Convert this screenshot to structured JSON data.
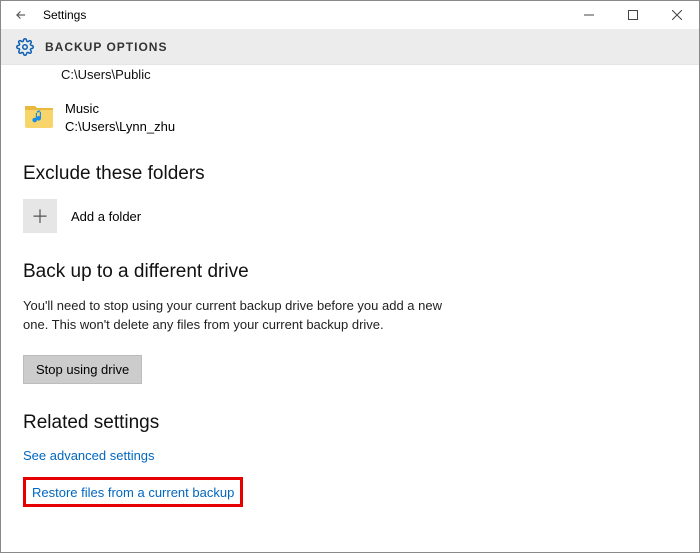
{
  "window": {
    "title": "Settings"
  },
  "page": {
    "header": "BACKUP OPTIONS",
    "truncated_path": "C:\\Users\\Public",
    "folder": {
      "name": "Music",
      "path": "C:\\Users\\Lynn_zhu"
    },
    "exclude": {
      "heading": "Exclude these folders",
      "add_label": "Add a folder"
    },
    "different_drive": {
      "heading": "Back up to a different drive",
      "description": "You'll need to stop using your current backup drive before you add a new one. This won't delete any files from your current backup drive.",
      "button": "Stop using drive"
    },
    "related": {
      "heading": "Related settings",
      "link_advanced": "See advanced settings",
      "link_restore": "Restore files from a current backup"
    }
  }
}
